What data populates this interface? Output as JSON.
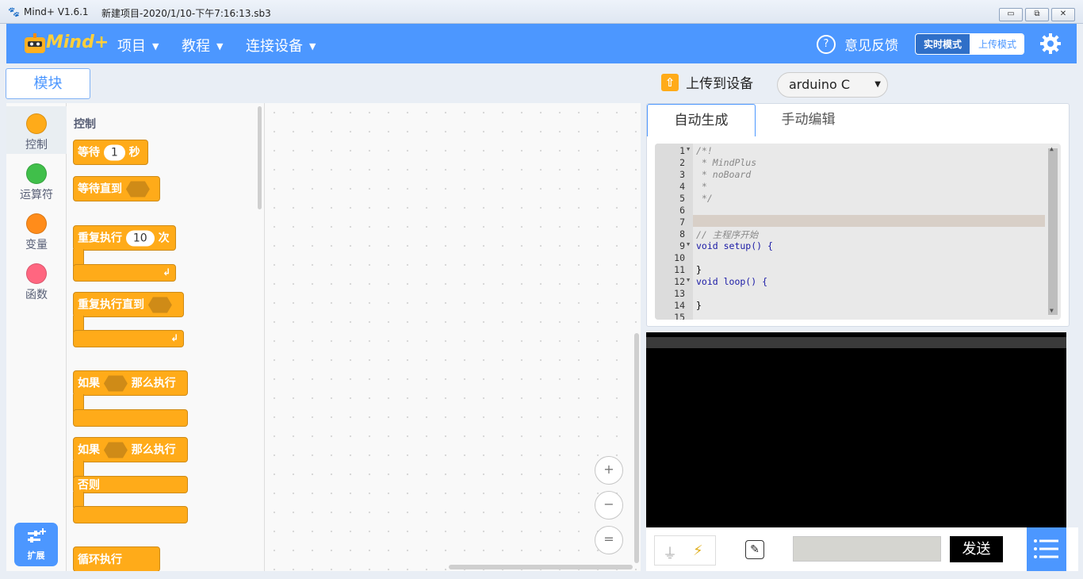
{
  "window": {
    "app_title": "Mind+ V1.6.1",
    "project_title": "新建项目-2020/1/10-下午7:16:13.sb3",
    "min_label": "▭",
    "restore_label": "⧉",
    "close_label": "✕"
  },
  "header": {
    "logo_text": "Mind+",
    "menus": [
      {
        "label": "项目"
      },
      {
        "label": "教程"
      },
      {
        "label": "连接设备"
      }
    ],
    "feedback_label": "意见反馈",
    "mode_realtime": "实时模式",
    "mode_upload": "上传模式",
    "accent_color": "#4c97ff"
  },
  "left": {
    "blocks_tab": "模块",
    "categories": [
      {
        "label": "控制",
        "color": "#ffab19"
      },
      {
        "label": "运算符",
        "color": "#40bf4a"
      },
      {
        "label": "变量",
        "color": "#ff8c1a"
      },
      {
        "label": "函数",
        "color": "#ff6680"
      }
    ],
    "palette_title": "控制",
    "blocks": {
      "wait": "等待",
      "wait_value": "1",
      "wait_unit": "秒",
      "wait_until": "等待直到",
      "repeat": "重复执行",
      "repeat_value": "10",
      "repeat_unit": "次",
      "repeat_until": "重复执行直到",
      "if_label": "如果",
      "then_label": "那么执行",
      "if2_label": "如果",
      "then2_label": "那么执行",
      "else_label": "否则",
      "forever": "循环执行"
    },
    "extend_label": "扩展"
  },
  "zoom": {
    "zoom_in": "+",
    "zoom_out": "−",
    "reset": "="
  },
  "right": {
    "upload_label": "上传到设备",
    "board_select": "arduino C",
    "tabs": [
      {
        "label": "自动生成"
      },
      {
        "label": "手动编辑"
      }
    ],
    "code_lines": [
      {
        "n": "1",
        "t": "/*!"
      },
      {
        "n": "2",
        "t": " * MindPlus"
      },
      {
        "n": "3",
        "t": " * noBoard"
      },
      {
        "n": "4",
        "t": " *"
      },
      {
        "n": "5",
        "t": " */"
      },
      {
        "n": "6",
        "t": ""
      },
      {
        "n": "7",
        "t": ""
      },
      {
        "n": "8",
        "t": "// 主程序开始"
      },
      {
        "n": "9",
        "t": "void setup() {"
      },
      {
        "n": "10",
        "t": ""
      },
      {
        "n": "11",
        "t": "}"
      },
      {
        "n": "12",
        "t": "void loop() {"
      },
      {
        "n": "13",
        "t": ""
      },
      {
        "n": "14",
        "t": "}"
      },
      {
        "n": "15",
        "t": ""
      }
    ],
    "send_label": "发送",
    "send_input": ""
  }
}
